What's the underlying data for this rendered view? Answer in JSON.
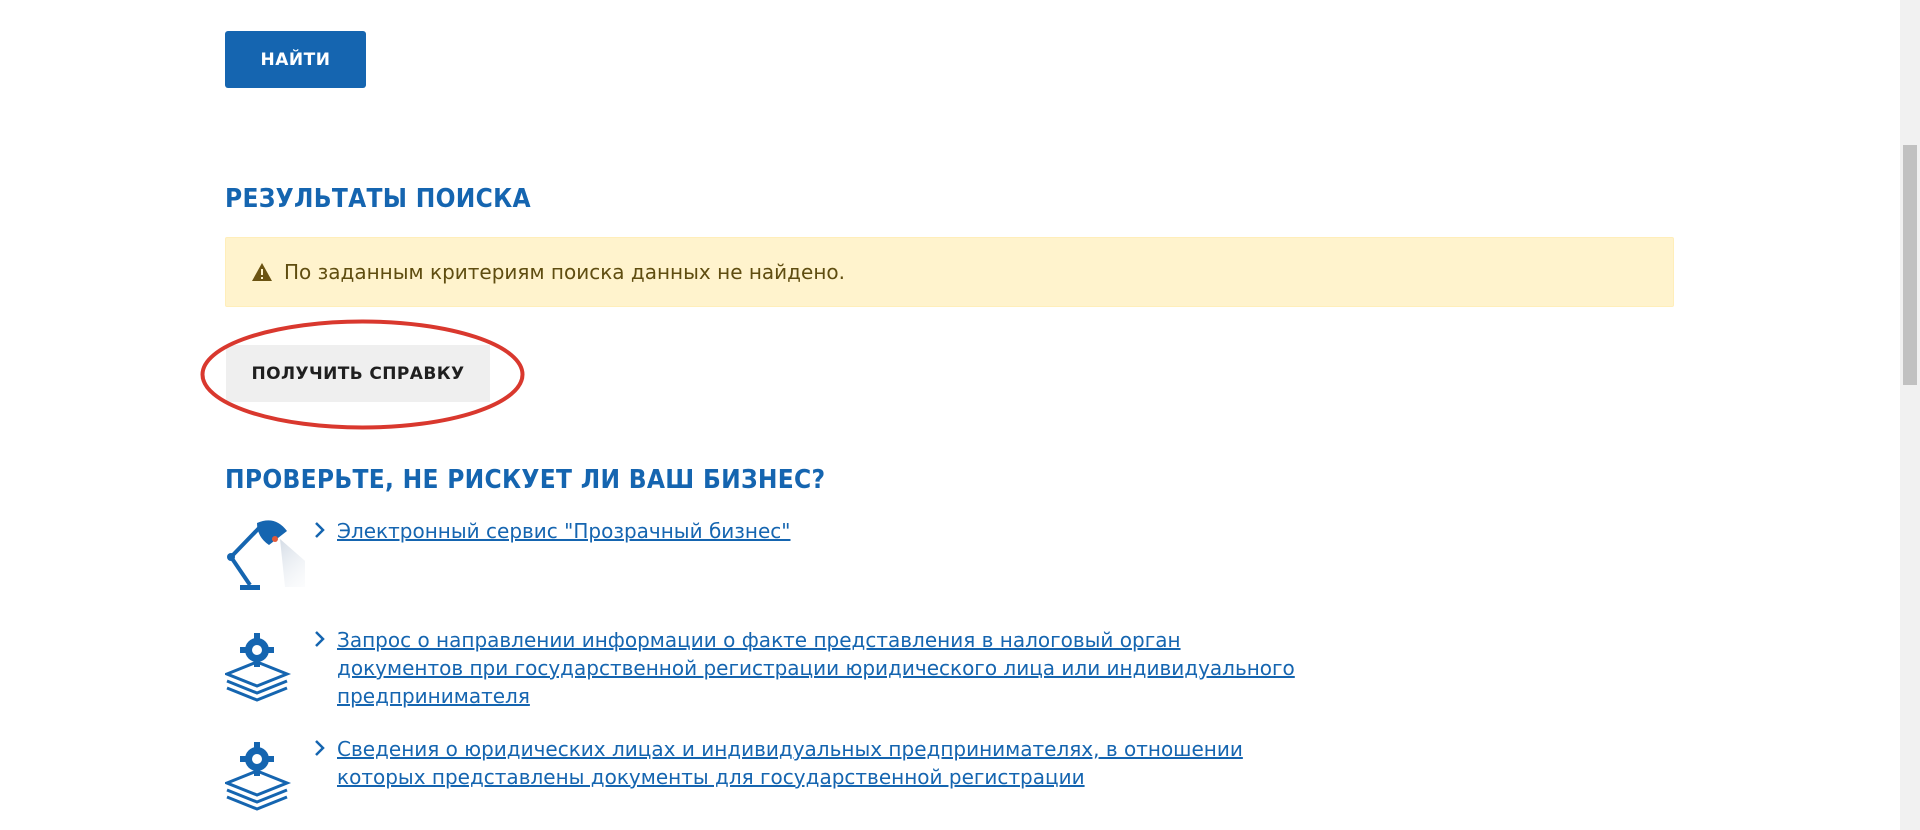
{
  "search_button": {
    "label": "НАЙТИ"
  },
  "results": {
    "title": "РЕЗУЛЬТАТЫ ПОИСКА",
    "alert_text": "По заданным критериям поиска данных не найдено."
  },
  "get_certificate_button": {
    "label": "ПОЛУЧИТЬ СПРАВКУ"
  },
  "risk_section": {
    "title": "ПРОВЕРЬТЕ, НЕ РИСКУЕТ ЛИ ВАШ БИЗНЕС?",
    "items": [
      {
        "icon": "desk-lamp-icon",
        "label": "Электронный сервис \"Прозрачный бизнес\""
      },
      {
        "icon": "gear-stack-icon",
        "label": "Запрос о направлении информации о факте представления в налоговый орган документов при государственной регистрации юридического лица или индивидуального предпринимателя"
      },
      {
        "icon": "gear-stack-icon",
        "label": "Сведения о юридических лицах и индивидуальных предпринимателях, в отношении которых представлены документы для государственной регистрации"
      }
    ]
  },
  "colors": {
    "primary": "#1565b0",
    "alert_bg": "#fff3cd",
    "alert_text": "#5f4d10",
    "highlight": "#d9382e",
    "secondary_button_bg": "#efefef"
  }
}
